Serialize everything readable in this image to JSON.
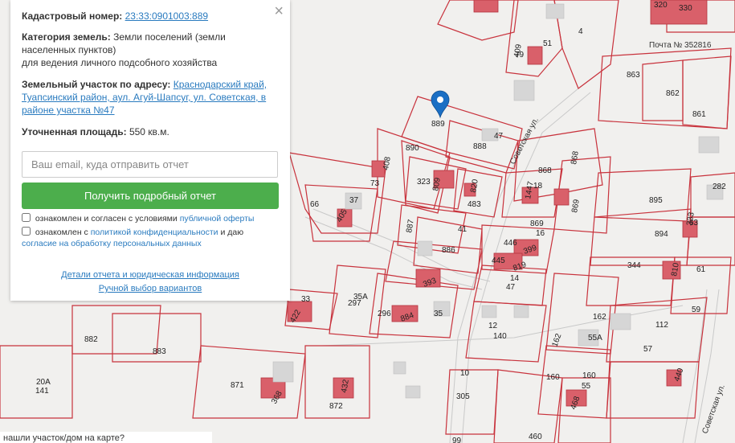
{
  "popup": {
    "cadastral_label": "Кадастровый номер:",
    "cadastral_value": "23:33:0901003:889",
    "category_label": "Категория земель:",
    "category_value": "Земли поселений (земли населенных пунктов)",
    "category_note": "для ведения личного подсобного хозяйства",
    "address_label": "Земельный участок по адресу:",
    "address_value": "Краснодарский край, Туапсинский район, аул. Агуй-Шапсуг, ул. Советская, в районе участка №47",
    "area_label": "Уточненная площадь:",
    "area_value": "550 кв.м.",
    "close_symbol": "×",
    "email_placeholder": "Ваш email, куда отправить отчет",
    "get_report_button": "Получить подробный отчет",
    "consent1_text": "ознакомлен и согласен с условиями",
    "consent1_link": "публичной оферты",
    "consent2_text": "ознакомлен с",
    "consent2_link": "политикой конфиденциальности",
    "consent2_mid": "и даю",
    "consent2_link2": "согласие на обработку персональных данных",
    "details_link": "Детали отчета и юридическая информация",
    "manual_link": "Ручной выбор вариантов"
  },
  "bottom_prompt": "нашли участок/дом на карте?",
  "map": {
    "parcel_labels": [
      "889",
      "890",
      "888",
      "47",
      "79",
      "409",
      "51",
      "4",
      "408",
      "73",
      "323",
      "809",
      "820",
      "483",
      "868",
      "868",
      "1447",
      "18",
      "869",
      "869",
      "37",
      "66",
      "405",
      "887",
      "41",
      "886",
      "446",
      "399",
      "16",
      "445",
      "819",
      "14",
      "47",
      "393",
      "33",
      "422",
      "35А",
      "297",
      "296",
      "884",
      "35",
      "12",
      "140",
      "895",
      "282",
      "894",
      "333",
      "63",
      "344",
      "810",
      "61",
      "162",
      "55А",
      "112",
      "57",
      "59",
      "882",
      "883",
      "871",
      "368",
      "872",
      "432",
      "20А",
      "141",
      "10",
      "305",
      "162",
      "160",
      "160",
      "55",
      "468",
      "440",
      "99",
      "460",
      "19",
      "863",
      "862",
      "861",
      "320",
      "330"
    ],
    "post_office_label": "Почта № 352816",
    "street_labels": [
      "Советская ул.",
      "Советская ул."
    ],
    "marker_icon": "location-pin-icon",
    "colors": {
      "boundary": "#c8323c",
      "building": "#d9606a",
      "popup_button": "#4cae4c",
      "link": "#2a7bbf"
    }
  }
}
